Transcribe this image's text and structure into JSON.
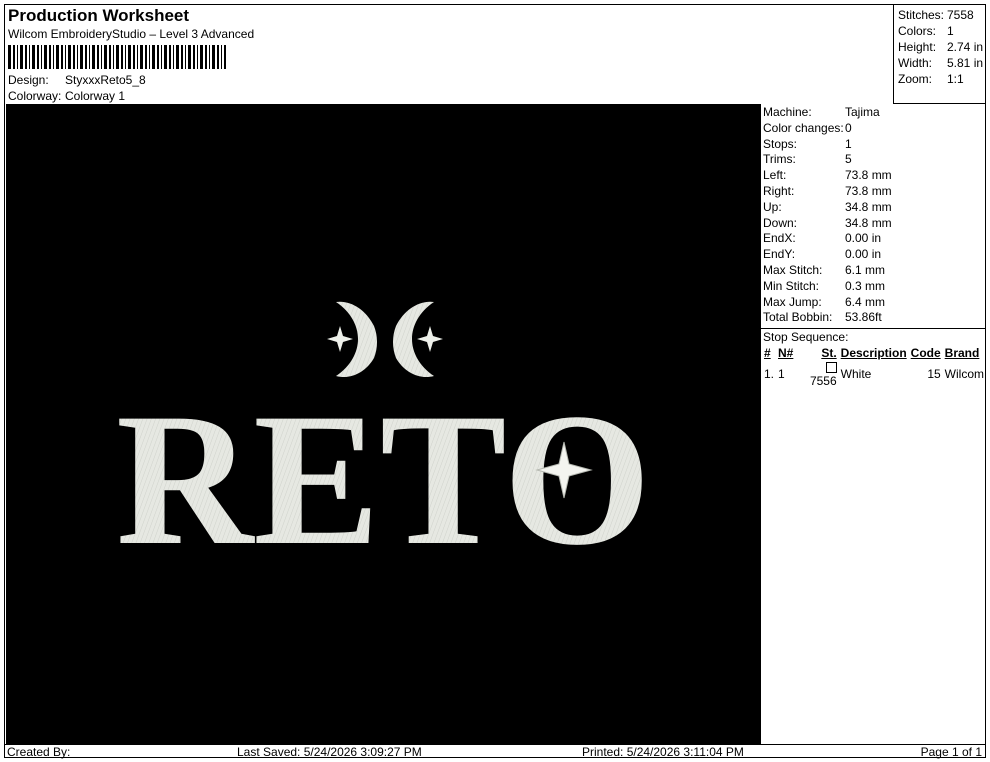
{
  "header": {
    "title": "Production Worksheet",
    "software": "Wilcom EmbroideryStudio – Level 3 Advanced",
    "design_label": "Design:",
    "design_value": "StyxxxReto5_8",
    "colorway_label": "Colorway:",
    "colorway_value": "Colorway 1"
  },
  "stats": [
    {
      "label": "Stitches:",
      "value": "7558"
    },
    {
      "label": "Colors:",
      "value": "1"
    },
    {
      "label": "Height:",
      "value": "2.74 in"
    },
    {
      "label": "Width:",
      "value": "5.81 in"
    },
    {
      "label": "Zoom:",
      "value": "1:1"
    }
  ],
  "design": {
    "text": "RETO",
    "background": "#000000",
    "thread_color": "#e9ebe6"
  },
  "machine_info": [
    {
      "label": "Machine:",
      "value": "Tajima"
    },
    {
      "label": "Color changes:",
      "value": "0"
    },
    {
      "label": "Stops:",
      "value": "1"
    },
    {
      "label": "Trims:",
      "value": "5"
    },
    {
      "label": "Left:",
      "value": "73.8 mm"
    },
    {
      "label": "Right:",
      "value": "73.8 mm"
    },
    {
      "label": "Up:",
      "value": "34.8 mm"
    },
    {
      "label": "Down:",
      "value": "34.8 mm"
    },
    {
      "label": "EndX:",
      "value": "0.00 in"
    },
    {
      "label": "EndY:",
      "value": "0.00 in"
    },
    {
      "label": "Max Stitch:",
      "value": "6.1 mm"
    },
    {
      "label": "Min Stitch:",
      "value": "0.3 mm"
    },
    {
      "label": "Max Jump:",
      "value": "6.4 mm"
    },
    {
      "label": "Total Bobbin:",
      "value": "53.86ft"
    }
  ],
  "stop_sequence": {
    "label": "Stop Sequence:",
    "columns": [
      "#",
      "N#",
      "St.",
      "Description",
      "Code",
      "Brand"
    ],
    "rows": [
      {
        "num": "1.",
        "n": "1",
        "st": "7556",
        "description": "White",
        "code": "15",
        "brand": "Wilcom"
      }
    ]
  },
  "footer": {
    "created_by": "Created By:",
    "last_saved": "Last Saved: 5/24/2026 3:09:27 PM",
    "printed": "Printed: 5/24/2026 3:11:04 PM",
    "page": "Page 1 of 1"
  }
}
